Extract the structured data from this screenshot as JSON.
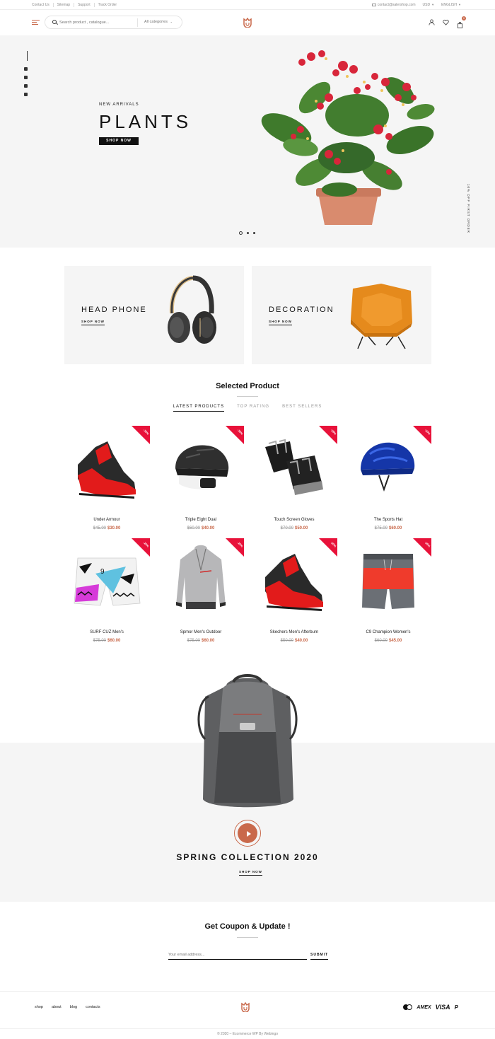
{
  "topbar": {
    "links": [
      "Contact Us",
      "Sitemap",
      "Support",
      "Track Order"
    ],
    "email": "contact@salershop.com",
    "currency": "USD",
    "language": "ENGLISH"
  },
  "header": {
    "search_placeholder": "Search product , catalogue...",
    "category_select": "All categories",
    "cart_count": "0"
  },
  "hero": {
    "eyebrow": "NEW ARRIVALS",
    "title": "PLANTS",
    "button": "SHOP NOW",
    "side_text": "10% OFF FIRST ORDER"
  },
  "categories": [
    {
      "title": "HEAD PHONE",
      "link": "SHOP NOW"
    },
    {
      "title": "DECORATION",
      "link": "SHOP NOW"
    }
  ],
  "selected": {
    "title": "Selected Product",
    "tabs": [
      "LATEST PRODUCTS",
      "TOP RATING",
      "BEST SELLERS"
    ]
  },
  "products": [
    {
      "name": "Under Armour",
      "old_price": "$45.00",
      "price": "$30.00",
      "badge": "-33%"
    },
    {
      "name": "Triple Eight Dual",
      "old_price": "$60.00",
      "price": "$40.00",
      "badge": "-33%"
    },
    {
      "name": "Touch Screen Gloves",
      "old_price": "$70.00",
      "price": "$50.00",
      "badge": "-29%"
    },
    {
      "name": "The Sports Hat",
      "old_price": "$75.00",
      "price": "$60.00",
      "badge": "-20%"
    },
    {
      "name": "SURF CUZ Men's",
      "old_price": "$75.00",
      "price": "$60.00",
      "badge": "-20%"
    },
    {
      "name": "Spmor Men's Outdoor",
      "old_price": "$75.00",
      "price": "$60.00",
      "badge": "-20%"
    },
    {
      "name": "Skechers Men's Afterburn",
      "old_price": "$50.00",
      "price": "$40.00",
      "badge": "-20%"
    },
    {
      "name": "C9 Champion Women's",
      "old_price": "$60.00",
      "price": "$45.00",
      "badge": "-25%"
    }
  ],
  "spring": {
    "title": "SPRING COLLECTION 2020",
    "link": "SHOP NOW"
  },
  "newsletter": {
    "title": "Get Coupon & Update !",
    "placeholder": "Your email address...",
    "submit": "SUBMIT"
  },
  "footer": {
    "nav": [
      "shop",
      "about",
      "blog",
      "contacts"
    ],
    "payments": [
      "AMEX",
      "VISA"
    ],
    "copyright": "© 2020 – Ecommerce WP By Webingo"
  },
  "colors": {
    "accent": "#c9694b",
    "sale": "#e8123a"
  }
}
